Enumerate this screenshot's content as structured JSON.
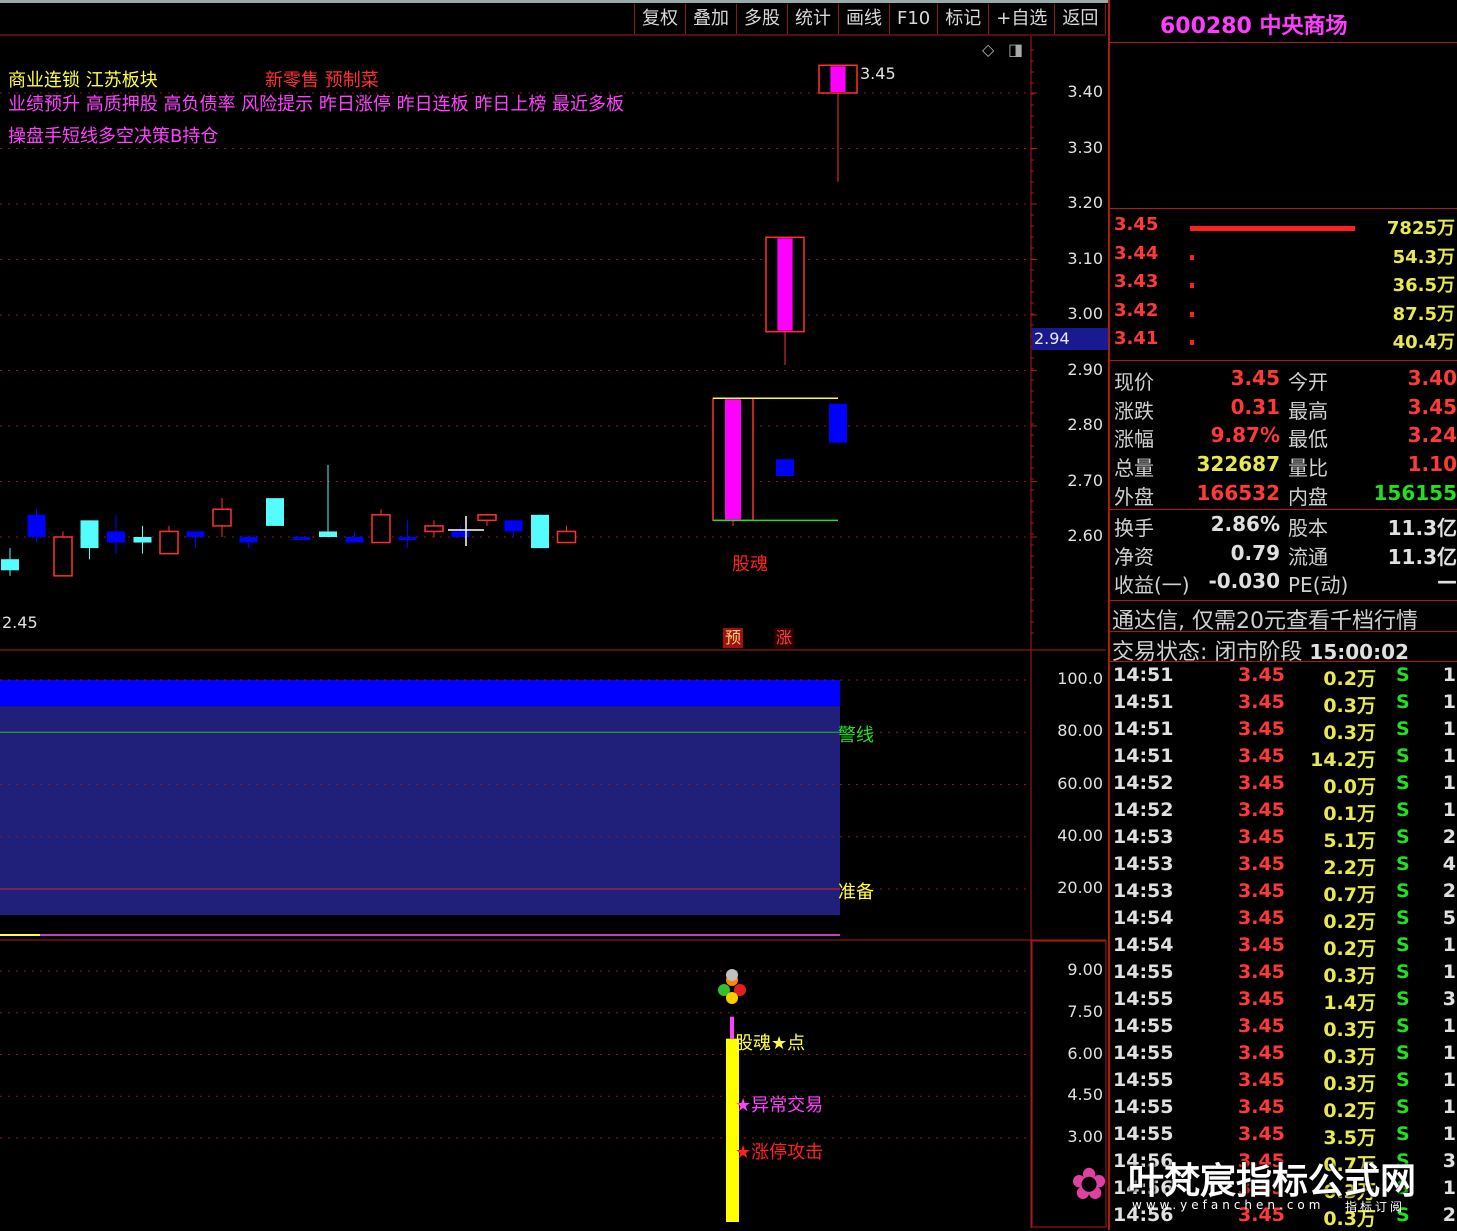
{
  "toolbar": {
    "items": [
      "复权",
      "叠加",
      "多股",
      "统计",
      "画线",
      "F10",
      "标记",
      "+自选",
      "返回"
    ]
  },
  "stock": {
    "code_name": "600280 中央商场"
  },
  "tags": {
    "line1_yellow": "商业连锁  江苏板块",
    "line1_red": "新零售 预制菜",
    "line2": "业绩预升 高质押股 高负债率 风险提示 昨日涨停 昨日连板 昨日上榜 最近多板",
    "line3": "操盘手短线多空决策B持仓"
  },
  "main_chart": {
    "y_ticks": [
      "3.40",
      "3.30",
      "3.20",
      "3.10",
      "3.00",
      "2.90",
      "2.80",
      "2.70",
      "2.60"
    ],
    "current_price_label": "2.94",
    "high_label": "3.45",
    "left_label": "2.45",
    "signal_label": "股魂",
    "markers": [
      "预",
      "涨"
    ]
  },
  "chart_data": [
    {
      "type": "candlestick",
      "title": "",
      "ylim": [
        2.45,
        3.47
      ],
      "candles": [
        {
          "o": 2.56,
          "h": 2.58,
          "l": 2.53,
          "c": 2.54,
          "dir": "down",
          "color": "cyan"
        },
        {
          "o": 2.6,
          "h": 2.65,
          "l": 2.59,
          "c": 2.64,
          "dir": "down",
          "color": "blue"
        },
        {
          "o": 2.53,
          "h": 2.61,
          "l": 2.53,
          "c": 2.6,
          "dir": "up"
        },
        {
          "o": 2.63,
          "h": 2.63,
          "l": 2.56,
          "c": 2.58,
          "dir": "down",
          "color": "cyan"
        },
        {
          "o": 2.61,
          "h": 2.64,
          "l": 2.57,
          "c": 2.59,
          "dir": "down",
          "color": "blue"
        },
        {
          "o": 2.6,
          "h": 2.62,
          "l": 2.57,
          "c": 2.59,
          "dir": "down",
          "color": "cyan"
        },
        {
          "o": 2.57,
          "h": 2.62,
          "l": 2.57,
          "c": 2.61,
          "dir": "up"
        },
        {
          "o": 2.61,
          "h": 2.61,
          "l": 2.58,
          "c": 2.6,
          "dir": "down",
          "color": "blue"
        },
        {
          "o": 2.62,
          "h": 2.67,
          "l": 2.6,
          "c": 2.65,
          "dir": "up"
        },
        {
          "o": 2.6,
          "h": 2.6,
          "l": 2.58,
          "c": 2.59,
          "dir": "down",
          "color": "blue"
        },
        {
          "o": 2.67,
          "h": 2.67,
          "l": 2.62,
          "c": 2.62,
          "dir": "down",
          "color": "cyan"
        },
        {
          "o": 2.6,
          "h": 2.6,
          "l": 2.6,
          "c": 2.6,
          "dir": "down",
          "color": "blue"
        },
        {
          "o": 2.61,
          "h": 2.73,
          "l": 2.6,
          "c": 2.6,
          "dir": "down",
          "color": "cyan"
        },
        {
          "o": 2.6,
          "h": 2.61,
          "l": 2.59,
          "c": 2.59,
          "dir": "down",
          "color": "blue"
        },
        {
          "o": 2.59,
          "h": 2.65,
          "l": 2.59,
          "c": 2.64,
          "dir": "up"
        },
        {
          "o": 2.6,
          "h": 2.63,
          "l": 2.58,
          "c": 2.6,
          "dir": "down",
          "color": "blue"
        },
        {
          "o": 2.61,
          "h": 2.63,
          "l": 2.6,
          "c": 2.62,
          "dir": "up"
        },
        {
          "o": 2.61,
          "h": 2.62,
          "l": 2.6,
          "c": 2.6,
          "dir": "down",
          "color": "blue"
        },
        {
          "o": 2.63,
          "h": 2.64,
          "l": 2.62,
          "c": 2.64,
          "dir": "up"
        },
        {
          "o": 2.63,
          "h": 2.63,
          "l": 2.6,
          "c": 2.61,
          "dir": "down",
          "color": "blue"
        },
        {
          "o": 2.64,
          "h": 2.64,
          "l": 2.58,
          "c": 2.58,
          "dir": "down",
          "color": "cyan"
        },
        {
          "o": 2.59,
          "h": 2.62,
          "l": 2.59,
          "c": 2.61,
          "dir": "up"
        },
        {
          "o": 2.63,
          "h": 2.85,
          "l": 2.62,
          "c": 2.85,
          "dir": "up",
          "fill": "magenta"
        },
        {
          "o": 2.74,
          "h": 2.74,
          "l": 2.71,
          "c": 2.71,
          "dir": "down",
          "color": "blue"
        },
        {
          "o": 2.97,
          "h": 3.14,
          "l": 2.91,
          "c": 3.14,
          "dir": "up",
          "fill": "magenta"
        },
        {
          "o": 2.84,
          "h": 2.84,
          "l": 2.77,
          "c": 2.77,
          "dir": "down",
          "color": "blue"
        },
        {
          "o": 3.4,
          "h": 3.45,
          "l": 3.24,
          "c": 3.45,
          "dir": "up",
          "fill": "magenta"
        }
      ],
      "lines": {
        "top_line": 2.85,
        "bottom_line": 2.63
      }
    },
    {
      "type": "area",
      "title": "",
      "ylim": [
        0,
        100
      ],
      "y_ticks": [
        "100.0",
        "80.00",
        "60.00",
        "40.00",
        "20.00"
      ],
      "band_values": {
        "top": 100,
        "bottom": 10
      },
      "reference_lines": [
        {
          "value": 80,
          "label": "警线"
        },
        {
          "value": 20,
          "label": "准备"
        }
      ]
    },
    {
      "type": "bar",
      "title": "",
      "ylim": [
        0,
        10
      ],
      "y_ticks": [
        "9.00",
        "7.50",
        "6.00",
        "4.50",
        "3.00"
      ],
      "bar_value": 7,
      "labels": [
        "股魂★点",
        "★异常交易",
        "★涨停攻击"
      ]
    }
  ],
  "order_book": [
    {
      "price": "3.45",
      "vol": "7825万",
      "bar_ratio": 1.0
    },
    {
      "price": "3.44",
      "vol": "54.3万",
      "bar_ratio": 0.02
    },
    {
      "price": "3.43",
      "vol": "36.5万",
      "bar_ratio": 0.02
    },
    {
      "price": "3.42",
      "vol": "87.5万",
      "bar_ratio": 0.02
    },
    {
      "price": "3.41",
      "vol": "40.4万",
      "bar_ratio": 0.02
    }
  ],
  "quote": [
    {
      "l1": "现价",
      "v1": "3.45",
      "c1": "#ff3838",
      "l2": "今开",
      "v2": "3.40",
      "c2": "#ff3838"
    },
    {
      "l1": "涨跌",
      "v1": "0.31",
      "c1": "#ff3838",
      "l2": "最高",
      "v2": "3.45",
      "c2": "#ff3838"
    },
    {
      "l1": "涨幅",
      "v1": "9.87%",
      "c1": "#ff3838",
      "l2": "最低",
      "v2": "3.24",
      "c2": "#ff3838"
    },
    {
      "l1": "总量",
      "v1": "322687",
      "c1": "#e8e850",
      "l2": "量比",
      "v2": "1.10",
      "c2": "#ff3838"
    },
    {
      "l1": "外盘",
      "v1": "166532",
      "c1": "#ff3838",
      "l2": "内盘",
      "v2": "156155",
      "c2": "#20e020"
    }
  ],
  "fundamentals": [
    {
      "l1": "换手",
      "v1": "2.86%",
      "l2": "股本",
      "v2": "11.3亿"
    },
    {
      "l1": "净资",
      "v1": "0.79",
      "l2": "流通",
      "v2": "11.3亿"
    },
    {
      "l1": "收益(一)",
      "v1": "-0.030",
      "l2": "PE(动)",
      "v2": "—"
    }
  ],
  "promo": "通达信, 仅需20元查看千档行情",
  "trade_status": {
    "label": "交易状态: 闭市阶段",
    "time": "15:00:02"
  },
  "ticks": [
    {
      "t": "14:51",
      "p": "3.45",
      "v": "0.2万",
      "s": "S",
      "n": "1"
    },
    {
      "t": "14:51",
      "p": "3.45",
      "v": "0.3万",
      "s": "S",
      "n": "1"
    },
    {
      "t": "14:51",
      "p": "3.45",
      "v": "0.3万",
      "s": "S",
      "n": "1"
    },
    {
      "t": "14:51",
      "p": "3.45",
      "v": "14.2万",
      "s": "S",
      "n": "1"
    },
    {
      "t": "14:52",
      "p": "3.45",
      "v": "0.0万",
      "s": "S",
      "n": "1"
    },
    {
      "t": "14:52",
      "p": "3.45",
      "v": "0.1万",
      "s": "S",
      "n": "1"
    },
    {
      "t": "14:53",
      "p": "3.45",
      "v": "5.1万",
      "s": "S",
      "n": "2"
    },
    {
      "t": "14:53",
      "p": "3.45",
      "v": "2.2万",
      "s": "S",
      "n": "4"
    },
    {
      "t": "14:53",
      "p": "3.45",
      "v": "0.7万",
      "s": "S",
      "n": "2"
    },
    {
      "t": "14:54",
      "p": "3.45",
      "v": "0.2万",
      "s": "S",
      "n": "5"
    },
    {
      "t": "14:54",
      "p": "3.45",
      "v": "0.2万",
      "s": "S",
      "n": "1"
    },
    {
      "t": "14:55",
      "p": "3.45",
      "v": "0.3万",
      "s": "S",
      "n": "1"
    },
    {
      "t": "14:55",
      "p": "3.45",
      "v": "1.4万",
      "s": "S",
      "n": "3"
    },
    {
      "t": "14:55",
      "p": "3.45",
      "v": "0.3万",
      "s": "S",
      "n": "1"
    },
    {
      "t": "14:55",
      "p": "3.45",
      "v": "0.3万",
      "s": "S",
      "n": "1"
    },
    {
      "t": "14:55",
      "p": "3.45",
      "v": "0.3万",
      "s": "S",
      "n": "1"
    },
    {
      "t": "14:55",
      "p": "3.45",
      "v": "0.2万",
      "s": "S",
      "n": "1"
    },
    {
      "t": "14:55",
      "p": "3.45",
      "v": "3.5万",
      "s": "S",
      "n": "1"
    },
    {
      "t": "14:56",
      "p": "3.45",
      "v": "0.7万",
      "s": "S",
      "n": "3"
    },
    {
      "t": "14:56",
      "p": "3.45",
      "v": "0.3万",
      "s": "S",
      "n": "1"
    },
    {
      "t": "14:56",
      "p": "3.45",
      "v": "0.3万",
      "s": "S",
      "n": "2"
    }
  ],
  "watermark": {
    "text": "叶梵宸指标公式网",
    "sub": "www.yefanchen.com",
    "sub2": "指标订阅"
  }
}
